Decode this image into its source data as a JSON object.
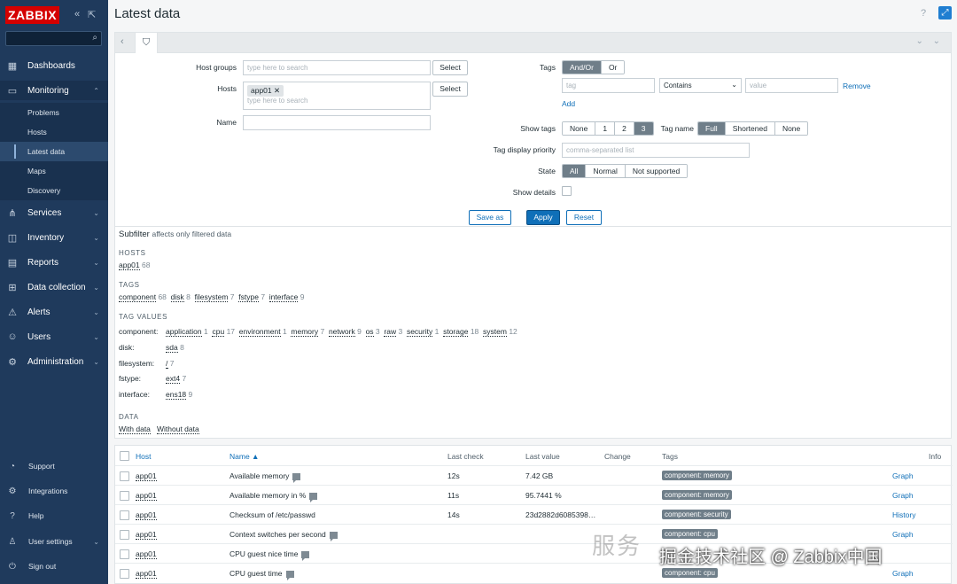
{
  "app": {
    "logo": "ZABBIX",
    "title": "Latest data",
    "help": "?"
  },
  "sidebar": {
    "collapse": "«",
    "kiosk": "⇲",
    "nav": [
      {
        "label": "Dashboards",
        "icon": "dashboard-icon"
      },
      {
        "label": "Monitoring",
        "icon": "monitoring-icon"
      },
      {
        "label": "Services",
        "icon": "services-icon"
      },
      {
        "label": "Inventory",
        "icon": "inventory-icon"
      },
      {
        "label": "Reports",
        "icon": "reports-icon"
      },
      {
        "label": "Data collection",
        "icon": "data-collection-icon"
      },
      {
        "label": "Alerts",
        "icon": "alerts-icon"
      },
      {
        "label": "Users",
        "icon": "users-icon"
      },
      {
        "label": "Administration",
        "icon": "administration-icon"
      }
    ],
    "monitoring_sub": [
      "Problems",
      "Hosts",
      "Latest data",
      "Maps",
      "Discovery"
    ],
    "bottom": [
      "Support",
      "Integrations",
      "Help",
      "User settings",
      "Sign out"
    ]
  },
  "filter": {
    "host_groups_label": "Host groups",
    "host_groups_placeholder": "type here to search",
    "hosts_label": "Hosts",
    "hosts_chip": "app01",
    "hosts_placeholder": "type here to search",
    "name_label": "Name",
    "select_label": "Select",
    "tags_label": "Tags",
    "tags_mode": [
      "And/Or",
      "Or"
    ],
    "tag_placeholder": "tag",
    "tag_operator": "Contains",
    "value_placeholder": "value",
    "remove_label": "Remove",
    "add_label": "Add",
    "show_tags_label": "Show tags",
    "show_tags_options": [
      "None",
      "1",
      "2",
      "3"
    ],
    "tag_name_label": "Tag name",
    "tag_name_options": [
      "Full",
      "Shortened",
      "None"
    ],
    "tag_priority_label": "Tag display priority",
    "tag_priority_placeholder": "comma-separated list",
    "state_label": "State",
    "state_options": [
      "All",
      "Normal",
      "Not supported"
    ],
    "show_details_label": "Show details",
    "save_as": "Save as",
    "apply": "Apply",
    "reset": "Reset"
  },
  "subfilter": {
    "title": "Subfilter",
    "note": "affects only filtered data",
    "hosts_head": "HOSTS",
    "hosts": [
      {
        "name": "app01",
        "count": "68"
      }
    ],
    "tags_head": "TAGS",
    "tags": [
      {
        "name": "component",
        "count": "68"
      },
      {
        "name": "disk",
        "count": "8"
      },
      {
        "name": "filesystem",
        "count": "7"
      },
      {
        "name": "fstype",
        "count": "7"
      },
      {
        "name": "interface",
        "count": "9"
      }
    ],
    "tag_values_head": "TAG VALUES",
    "tag_values": [
      {
        "key": "component:",
        "values": [
          {
            "name": "application",
            "count": "1"
          },
          {
            "name": "cpu",
            "count": "17"
          },
          {
            "name": "environment",
            "count": "1"
          },
          {
            "name": "memory",
            "count": "7"
          },
          {
            "name": "network",
            "count": "9"
          },
          {
            "name": "os",
            "count": "3"
          },
          {
            "name": "raw",
            "count": "3"
          },
          {
            "name": "security",
            "count": "1"
          },
          {
            "name": "storage",
            "count": "18"
          },
          {
            "name": "system",
            "count": "12"
          }
        ]
      },
      {
        "key": "disk:",
        "values": [
          {
            "name": "sda",
            "count": "8"
          }
        ]
      },
      {
        "key": "filesystem:",
        "values": [
          {
            "name": "/",
            "count": "7"
          }
        ]
      },
      {
        "key": "fstype:",
        "values": [
          {
            "name": "ext4",
            "count": "7"
          }
        ]
      },
      {
        "key": "interface:",
        "values": [
          {
            "name": "ens18",
            "count": "9"
          }
        ]
      }
    ],
    "data_head": "DATA",
    "data": [
      "With data",
      "Without data"
    ]
  },
  "table": {
    "headers": {
      "host": "Host",
      "name": "Name ▲",
      "last_check": "Last check",
      "last_value": "Last value",
      "change": "Change",
      "tags": "Tags",
      "info": "Info"
    },
    "rows": [
      {
        "host": "app01",
        "name": "Available memory",
        "last_check": "12s",
        "last_value": "7.42 GB",
        "tag": "component: memory",
        "action": "Graph"
      },
      {
        "host": "app01",
        "name": "Available memory in %",
        "last_check": "11s",
        "last_value": "95.7441 %",
        "tag": "component: memory",
        "action": "Graph"
      },
      {
        "host": "app01",
        "name": "Checksum of /etc/passwd",
        "last_check": "14s",
        "last_value": "23d2882d6085398…",
        "tag": "component: security",
        "action": "History"
      },
      {
        "host": "app01",
        "name": "Context switches per second",
        "last_check": "",
        "last_value": "",
        "tag": "component: cpu",
        "action": "Graph"
      },
      {
        "host": "app01",
        "name": "CPU guest nice time",
        "last_check": "",
        "last_value": "",
        "tag": "",
        "action": ""
      },
      {
        "host": "app01",
        "name": "CPU guest time",
        "last_check": "",
        "last_value": "",
        "tag": "component: cpu",
        "action": "Graph"
      }
    ]
  },
  "watermark": {
    "line1": "服务",
    "line2": "掘金技术社区 @ Zabbix中国"
  }
}
